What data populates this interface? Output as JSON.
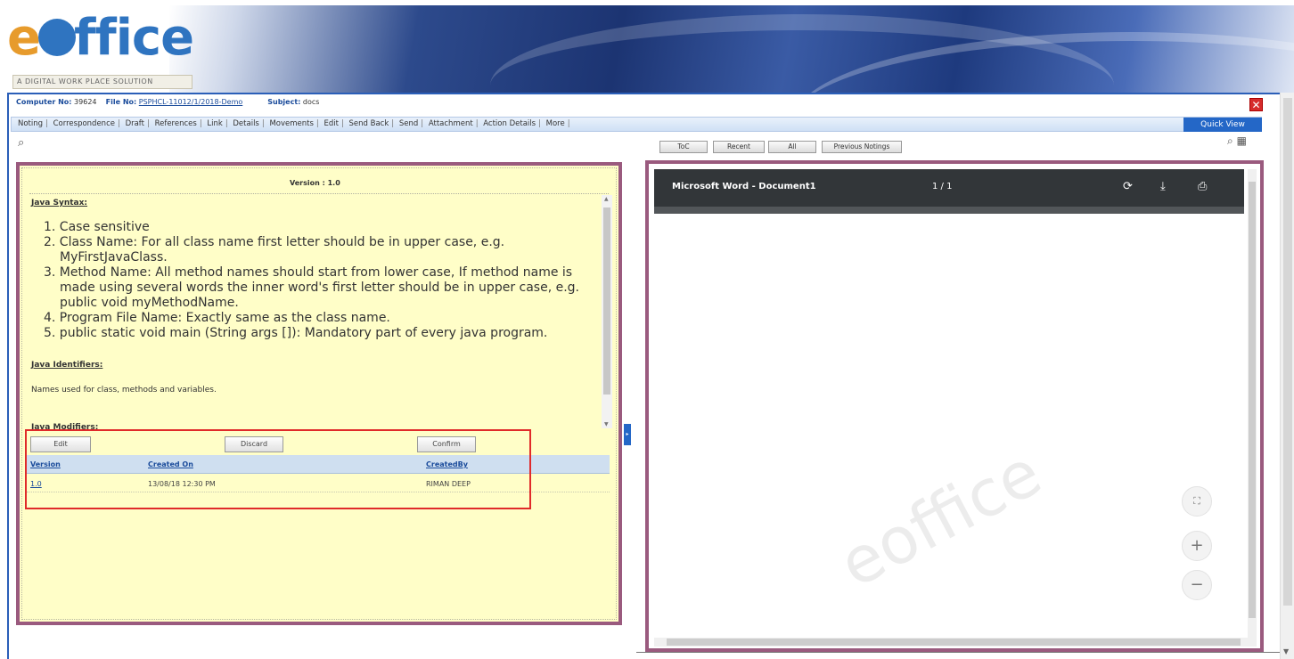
{
  "branding": {
    "logo_e": "e",
    "logo_rest": "ffice",
    "tagline": "A DIGITAL WORK PLACE SOLUTION"
  },
  "file_info": {
    "computer_no_label": "Computer No:",
    "computer_no": "39624",
    "file_no_label": "File No:",
    "file_no": "PSPHCL-11012/1/2018-Demo",
    "subject_label": "Subject:",
    "subject": "docs"
  },
  "menu": {
    "items": [
      "Noting",
      "Correspondence",
      "Draft",
      "References",
      "Link",
      "Details",
      "Movements",
      "Edit",
      "Send Back",
      "Send",
      "Attachment",
      "Action Details",
      "More"
    ],
    "quick_view": "Quick View"
  },
  "tabs": [
    "ToC",
    "Recent",
    "All",
    "Previous Notings"
  ],
  "noting": {
    "version_header": "Version : 1.0",
    "java_syntax_heading": "Java Syntax:",
    "syntax_items": [
      "1. Case sensitive",
      "2. Class Name: For all class name first letter should be in upper case, e.g. MyFirstJavaClass.",
      "3. Method Name: All method names should start from lower case, If method name is made using several words the inner word's first letter should be in upper case, e.g. public void myMethodName.",
      "4. Program File Name: Exactly same as the class name.",
      "5. public static void main (String args []): Mandatory part of every java program."
    ],
    "identifiers_heading": "Java Identifiers:",
    "identifiers_text": "Names used for class, methods and variables.",
    "modifiers_heading": "Java Modifiers:"
  },
  "actions": {
    "edit": "Edit",
    "discard": "Discard",
    "confirm": "Confirm"
  },
  "version_table": {
    "headers": [
      "Version",
      "Created On",
      "CreatedBy"
    ],
    "rows": [
      {
        "version": "1.0",
        "created_on": "13/08/18 12:30 PM",
        "created_by": "RIMAN DEEP"
      }
    ]
  },
  "viewer": {
    "title": "Microsoft Word - Document1",
    "page": "1 / 1",
    "watermark": "eoffice",
    "icons": [
      "rotate-icon",
      "download-icon",
      "print-icon",
      "fit-page-icon",
      "zoom-in-icon",
      "zoom-out-icon"
    ]
  },
  "colors": {
    "accent_blue": "#2467c7",
    "panel_border": "#9a5a7e",
    "noting_bg": "#fffec8",
    "highlight_red": "#e02a2a"
  }
}
